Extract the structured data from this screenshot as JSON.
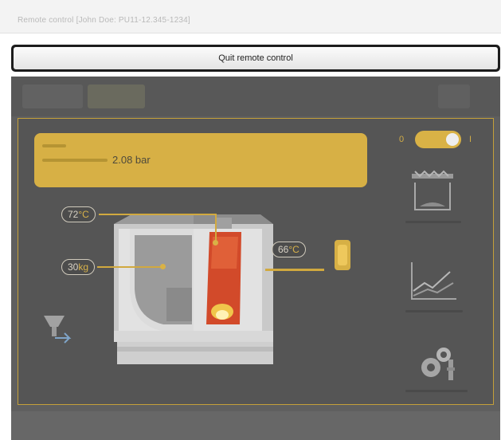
{
  "window": {
    "title": "Remote control [John Doe: PU11-12.345-1234]"
  },
  "toolbar": {
    "quit_label": "Quit remote control"
  },
  "panel": {
    "pressure_value": "2.08 bar",
    "switch": {
      "off_label": "0",
      "on_label": "I",
      "state": "on"
    }
  },
  "boiler": {
    "flue_temp": "72",
    "flue_temp_unit": "°C",
    "pellet_amount": "30",
    "pellet_unit": "kg",
    "buffer_temp": "66",
    "buffer_temp_unit": "°C"
  },
  "side_menu": {
    "items": [
      {
        "icon": "conveyor-icon"
      },
      {
        "icon": "line-chart-icon"
      },
      {
        "icon": "gears-settings-icon"
      }
    ]
  },
  "colors": {
    "accent": "#d7b045",
    "stage": "#5f5f5f"
  }
}
